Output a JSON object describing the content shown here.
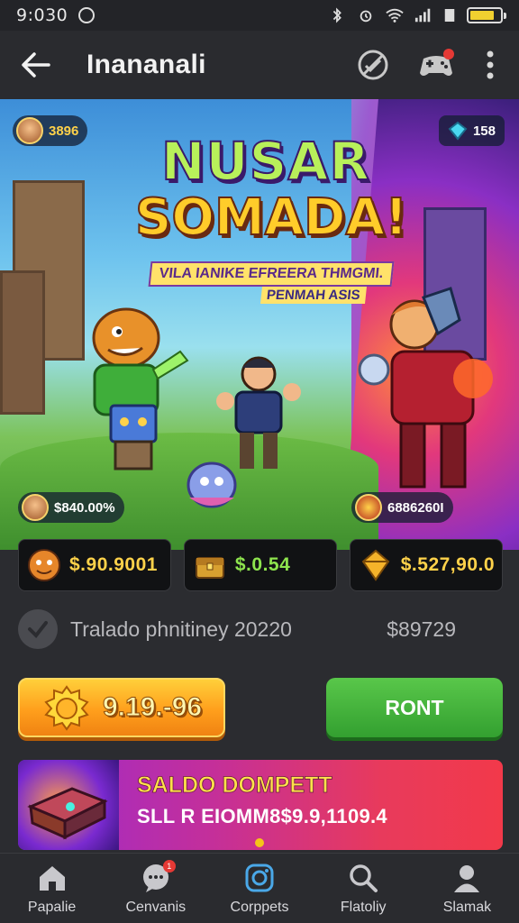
{
  "status_bar": {
    "time": "9:030"
  },
  "app_bar": {
    "title": "Inananali"
  },
  "hero": {
    "title_line1": "NUSAR",
    "title_line2": "SOMADA!",
    "subtitle_line1": "VILA IANIKE EFREERA THMGMI.",
    "subtitle_line2": "PENMAH ASIS",
    "top_left_chip": "3896",
    "top_right_chip": "158",
    "bottom_left_chip": "$840.00%",
    "bottom_right_chip": "6886260I"
  },
  "stats": [
    {
      "value": "$.90.9001",
      "icon": "hero-avatar-icon"
    },
    {
      "value": "$.0.54",
      "icon": "treasure-chest-icon"
    },
    {
      "value": "$.527,90.0",
      "icon": "gold-gem-icon"
    }
  ],
  "info": {
    "text": "Tralado phnitiney 20220",
    "amount": "$89729"
  },
  "buttons": {
    "gold_value": "9.19.-96",
    "green_label": "RONT"
  },
  "promo": {
    "title": "SALDO DOMPETT",
    "subtitle": "SLL R EIOMM8$9.9,1109.4"
  },
  "nav": [
    {
      "label": "Papalie",
      "icon": "home-icon"
    },
    {
      "label": "Cenvanis",
      "icon": "chat-bubble-icon",
      "badge": "1"
    },
    {
      "label": "Corppets",
      "icon": "camera-icon"
    },
    {
      "label": "Flatoliy",
      "icon": "search-icon"
    },
    {
      "label": "Slamak",
      "icon": "profile-icon"
    }
  ],
  "colors": {
    "gold": "#ffd24a",
    "green_value": "#8ee44e",
    "accent_button": "#ff9f1c",
    "green_button": "#33a030"
  }
}
